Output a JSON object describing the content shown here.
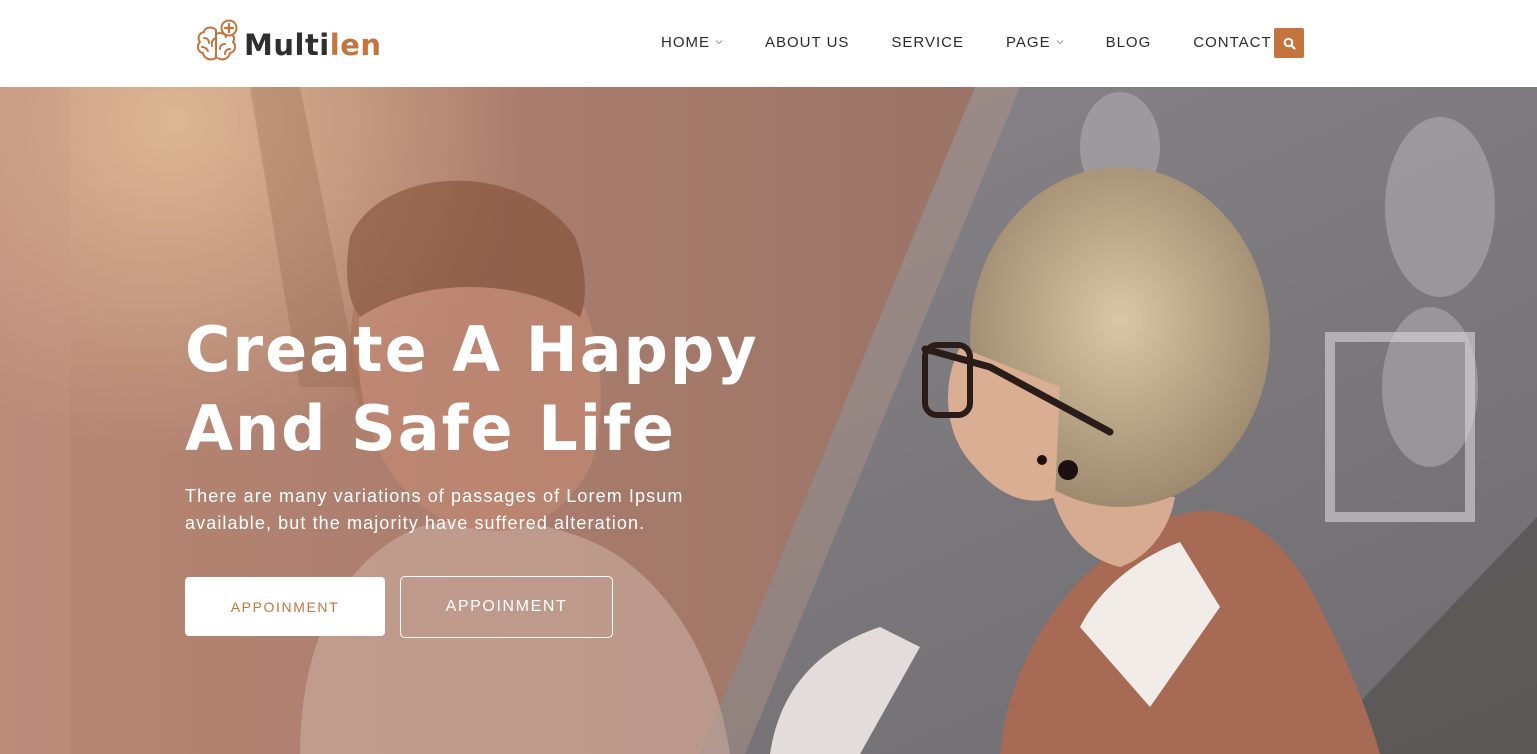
{
  "brand": {
    "name_dark": "Multi",
    "name_accent": "len",
    "logo_icon": "brain-medical-icon",
    "accent_color": "#c4743f",
    "dark_color": "#2f2f2f"
  },
  "nav": {
    "items": [
      {
        "label": "HOME",
        "has_dropdown": true
      },
      {
        "label": "ABOUT US",
        "has_dropdown": false
      },
      {
        "label": "SERVICE",
        "has_dropdown": false
      },
      {
        "label": "PAGE",
        "has_dropdown": true
      },
      {
        "label": "BLOG",
        "has_dropdown": false
      },
      {
        "label": "CONTACT",
        "has_dropdown": false
      }
    ],
    "search_icon": "search-icon"
  },
  "hero": {
    "title_line1": "Create A Happy",
    "title_line2": "And Safe Life",
    "subtitle_line1": "There are many variations of passages of Lorem Ipsum",
    "subtitle_line2": "available, but the majority have suffered alteration.",
    "primary_button": "APPOINMENT",
    "secondary_button": "APPOINMENT",
    "overlay_color": "#a87a6a",
    "background_image": "therapy-session-photo"
  }
}
